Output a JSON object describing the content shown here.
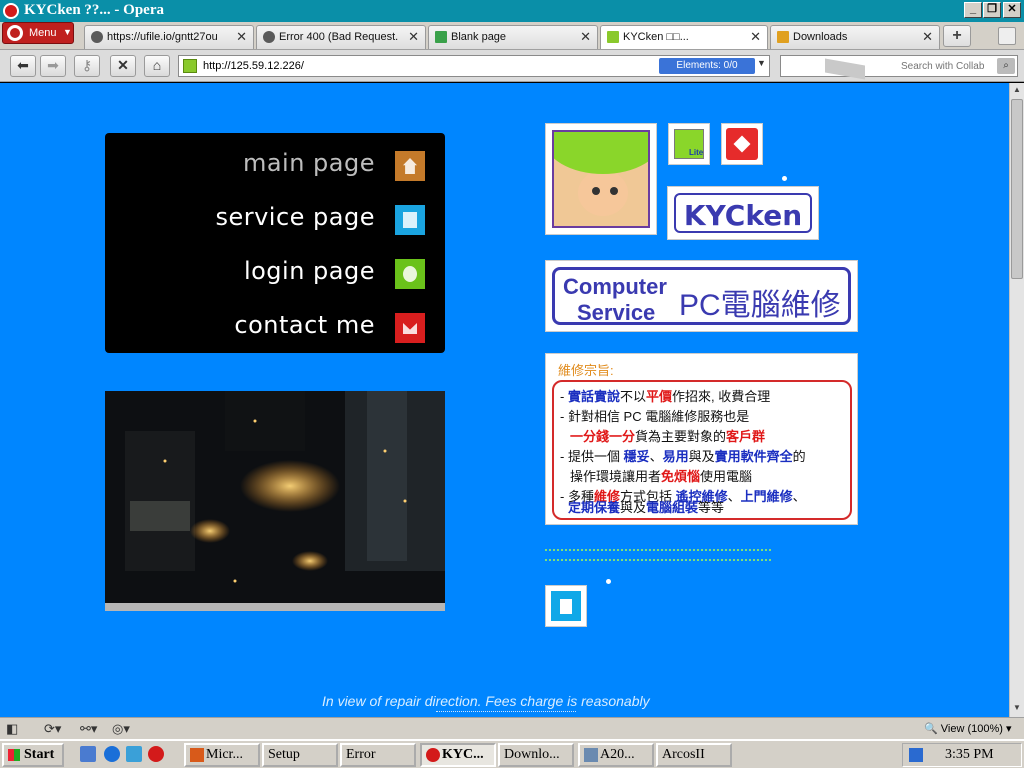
{
  "window": {
    "title": "KYCken ??... - Opera"
  },
  "browser": {
    "menu_label": "Menu",
    "tabs": [
      {
        "label": "https://ufile.io/gntt27ou"
      },
      {
        "label": "Error 400 (Bad Request..."
      },
      {
        "label": "Blank page"
      },
      {
        "label": "KYCken □□..."
      },
      {
        "label": "Downloads"
      }
    ],
    "new_tab": "+",
    "url": "http://125.59.12.226/",
    "elements_badge": "Elements: 0/0",
    "search_placeholder": "Search with Collab"
  },
  "page": {
    "nav": [
      {
        "label": "main page",
        "icon": "home-icon",
        "color": "#c47a2a"
      },
      {
        "label": "service page",
        "icon": "document-icon",
        "color": "#1aa4e0"
      },
      {
        "label": "login page",
        "icon": "user-icon",
        "color": "#6ac21a"
      },
      {
        "label": "contact me",
        "icon": "mail-icon",
        "color": "#d81e1e"
      }
    ],
    "lite_label": "Lite",
    "brand": "KYCken",
    "service_en_1": "Computer",
    "service_en_2": "Service",
    "service_zh": "PC電腦維修",
    "mission_title": "維修宗旨:",
    "mission_lines": [
      [
        "- ",
        "實話實說",
        "不以",
        "平價",
        "作招來, 收費合理"
      ],
      [
        "- 針對相信 PC 電腦維修服務也是"
      ],
      [
        "一分錢一分",
        "貨為主要對象的",
        "客戶群"
      ],
      [
        "- 提供一個 ",
        "穩妥",
        "、",
        "易用",
        "與及",
        "實用軟件齊全",
        "的"
      ],
      [
        "操作環境讓用者",
        "免煩惱",
        "使用電腦"
      ],
      [
        "- 多種",
        "維修",
        "方式包括 ",
        "遙控維修",
        "、",
        "上門維修",
        "、"
      ],
      [
        "定期保養",
        "與及",
        "電腦組裝",
        "等等"
      ]
    ],
    "footer": "In view of repair direction. Fees charge is reasonably"
  },
  "statusbar": {
    "zoom": "View (100%)"
  },
  "taskbar": {
    "start": "Start",
    "tasks": [
      "Micr...",
      "Setup",
      "Error",
      "KYC...",
      "Downlo...",
      "A20...",
      "ArcosII"
    ],
    "clock": "3:35 PM"
  },
  "colors": {
    "page_bg": "#0086ff",
    "brand_blue": "#3a3ab0",
    "accent_red": "#d42a2a"
  }
}
